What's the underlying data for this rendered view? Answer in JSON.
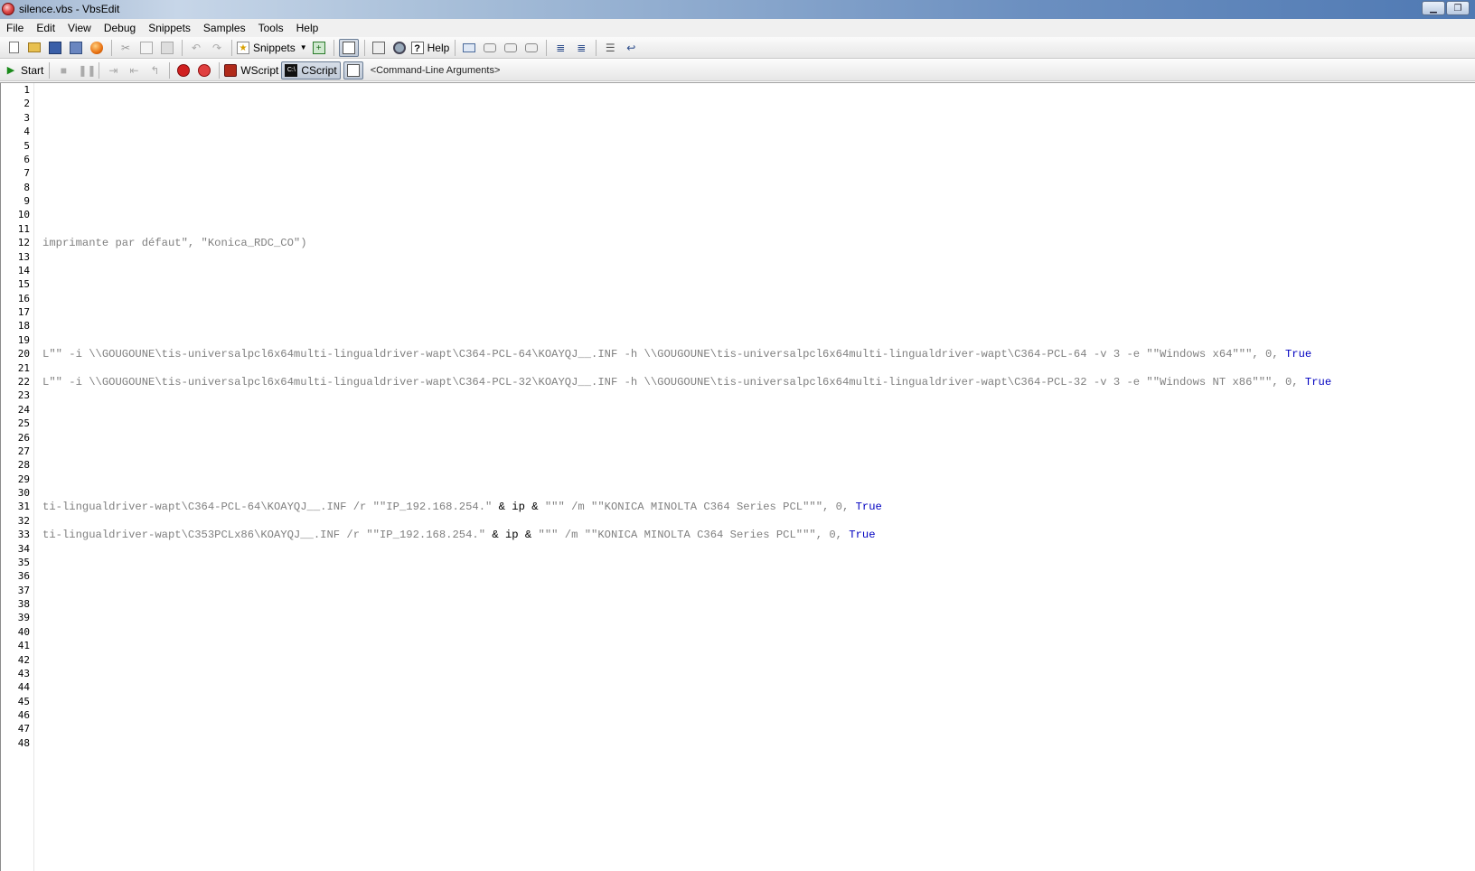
{
  "window": {
    "title": "silence.vbs - VbsEdit",
    "buttons": {
      "minimize": "▁",
      "restore": "❐"
    }
  },
  "menu": [
    "File",
    "Edit",
    "View",
    "Debug",
    "Snippets",
    "Samples",
    "Tools",
    "Help"
  ],
  "toolbar1": {
    "snippets_label": "Snippets",
    "help_label": "Help"
  },
  "toolbar2": {
    "start_label": "Start",
    "wscript_label": "WScript",
    "cscript_label": "CScript",
    "args_placeholder": "<Command-Line Arguments>"
  },
  "icons": {
    "new": "new-file-icon",
    "open": "open-folder-icon",
    "save": "save-icon",
    "save_all": "save-all-icon",
    "record": "record-icon",
    "cut": "cut-icon",
    "copy": "copy-icon",
    "paste": "paste-icon",
    "undo": "undo-icon",
    "redo": "redo-icon",
    "snippets": "snippets-icon",
    "insert": "insert-icon",
    "toggle": "toggle-icon",
    "find": "find-icon",
    "object_browser": "object-browser-icon",
    "help": "help-icon",
    "comment": "comment-icon",
    "bubble": "bubble-icon",
    "indent": "indent-icon",
    "outdent": "outdent-icon",
    "play": "play-icon",
    "stop": "stop-icon",
    "pause": "pause-icon",
    "step_into": "step-into-icon",
    "step_over": "step-over-icon",
    "step_out": "step-out-icon",
    "breakpoint": "breakpoint-icon",
    "clear_breakpoints": "clear-breakpoints-icon",
    "wscript": "wscript-icon",
    "cscript": "cscript-icon",
    "output": "output-window-icon"
  },
  "editor": {
    "line_count": 48,
    "lines": {
      "12": [
        {
          "t": "imprimante par défaut\", \"Konica_RDC_CO\")",
          "k": "str"
        }
      ],
      "20": [
        {
          "t": "L\"\" -i \\\\GOUGOUNE\\tis-universalpcl6x64multi-lingualdriver-wapt\\C364-PCL-64\\KOAYQJ__.INF -h \\\\GOUGOUNE\\tis-universalpcl6x64multi-lingualdriver-wapt\\C364-PCL-64 -v 3 -e \"\"Windows x64\"\"\", 0, ",
          "k": "str"
        },
        {
          "t": "True",
          "k": "kw"
        }
      ],
      "22": [
        {
          "t": "L\"\" -i \\\\GOUGOUNE\\tis-universalpcl6x64multi-lingualdriver-wapt\\C364-PCL-32\\KOAYQJ__.INF -h \\\\GOUGOUNE\\tis-universalpcl6x64multi-lingualdriver-wapt\\C364-PCL-32 -v 3 -e \"\"Windows NT x86\"\"\", 0, ",
          "k": "str"
        },
        {
          "t": "True",
          "k": "kw"
        }
      ],
      "31": [
        {
          "t": "ti-lingualdriver-wapt\\C364-PCL-64\\KOAYQJ__.INF /r \"\"IP_192.168.254.\" ",
          "k": "str"
        },
        {
          "t": "& ip &",
          "k": "op"
        },
        {
          "t": " \"\"\" /m \"\"KONICA MINOLTA C364 Series PCL\"\"\", 0, ",
          "k": "str"
        },
        {
          "t": "True",
          "k": "kw"
        }
      ],
      "33": [
        {
          "t": "ti-lingualdriver-wapt\\C353PCLx86\\KOAYQJ__.INF /r \"\"IP_192.168.254.\" ",
          "k": "str"
        },
        {
          "t": "& ip &",
          "k": "op"
        },
        {
          "t": " \"\"\" /m \"\"KONICA MINOLTA C364 Series PCL\"\"\", 0, ",
          "k": "str"
        },
        {
          "t": "True",
          "k": "kw"
        }
      ]
    }
  }
}
